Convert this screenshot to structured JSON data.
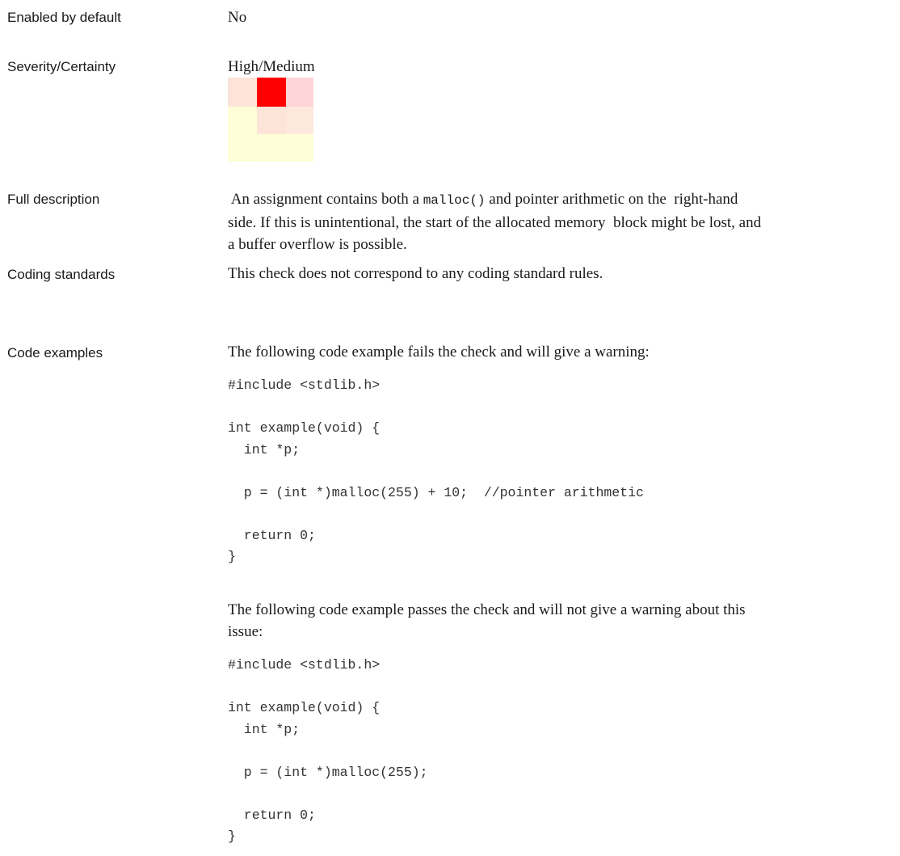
{
  "rows": {
    "enabled_by_default": {
      "label": "Enabled by default",
      "value": "No"
    },
    "severity_certainty": {
      "label": "Severity/Certainty",
      "value": "High/Medium"
    },
    "full_description": {
      "label": "Full description",
      "line1_prefix": " An assignment contains both a ",
      "line1_code": "malloc()",
      "line1_suffix": " and pointer arithmetic on the  right-hand",
      "line2": "side. If this is unintentional, the start of the allocated memory  block might be lost, and",
      "line3": "a buffer overflow is possible."
    },
    "coding_standards": {
      "label": "Coding standards",
      "value": "This check does not correspond to any coding standard rules."
    },
    "code_examples": {
      "label": "Code examples",
      "fail_intro": "The following code example fails the check and will give a warning:",
      "fail_code": "#include <stdlib.h>\n\nint example(void) {\n  int *p;\n\n  p = (int *)malloc(255) + 10;  //pointer arithmetic\n\n  return 0;\n}",
      "pass_intro_line1": "The following code example passes the check and will not give a warning about this",
      "pass_intro_line2": "issue:",
      "pass_code": "#include <stdlib.h>\n\nint example(void) {\n  int *p;\n\n  p = (int *)malloc(255);\n\n  return 0;\n}"
    }
  },
  "severity_matrix": {
    "colors": [
      [
        "#fde3d9",
        "#ff0000",
        "#fdd5d8"
      ],
      [
        "#fefed6",
        "#fde4d8",
        "#fde9dc"
      ],
      [
        "#fefed6",
        "#feffd8",
        "#feffd8"
      ]
    ]
  }
}
